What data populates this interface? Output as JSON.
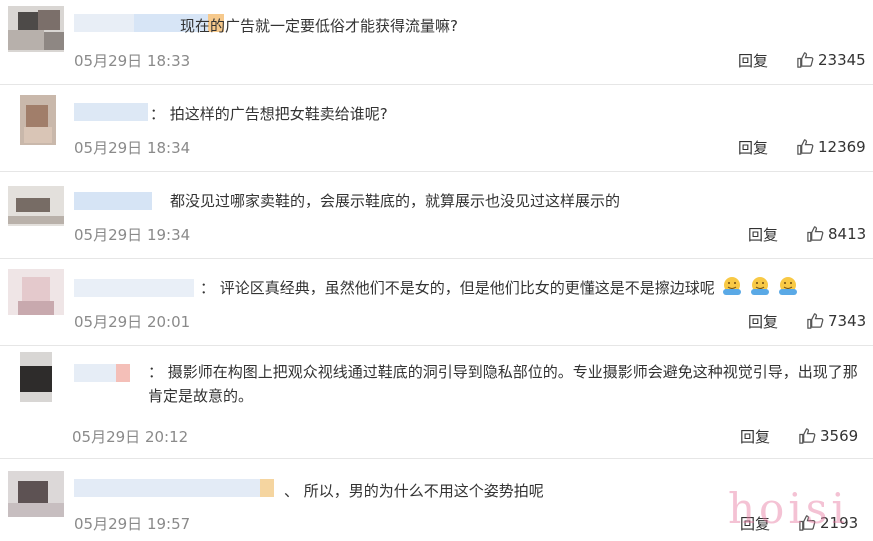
{
  "comments": [
    {
      "text": "现在的广告就一定要低俗才能获得流量嘛?",
      "time": "05月29日 18:33",
      "reply": "回复",
      "likes": "23345"
    },
    {
      "text": "：  拍这样的广告想把女鞋卖给谁呢?",
      "time": "05月29日 18:34",
      "reply": "回复",
      "likes": "12369"
    },
    {
      "text": "都没见过哪家卖鞋的，会展示鞋底的，就算展示也没见过这样展示的",
      "time": "05月29日 19:34",
      "reply": "回复",
      "likes": "8413"
    },
    {
      "text": "：  评论区真经典，虽然他们不是女的，但是他们比女的更懂这是不是擦边球呢",
      "time": "05月29日 20:01",
      "reply": "回复",
      "likes": "7343",
      "emoji": "hug-emoji"
    },
    {
      "text": "：  摄影师在构图上把观众视线通过鞋底的洞引导到隐私部位的。专业摄影师会避免这种视觉引导，出现了那肯定是故意的。",
      "time": "05月29日 20:12",
      "reply": "回复",
      "likes": "3569"
    },
    {
      "text": "、 所以，男的为什么不用这个姿势拍呢",
      "time": "05月29日 19:57",
      "reply": "回复",
      "likes": "2193"
    }
  ],
  "watermark": "hoisi",
  "colors": {
    "text": "#333333",
    "time": "#8a8a8a",
    "divider": "#e6e6e6",
    "watermark": "#e678a0"
  }
}
